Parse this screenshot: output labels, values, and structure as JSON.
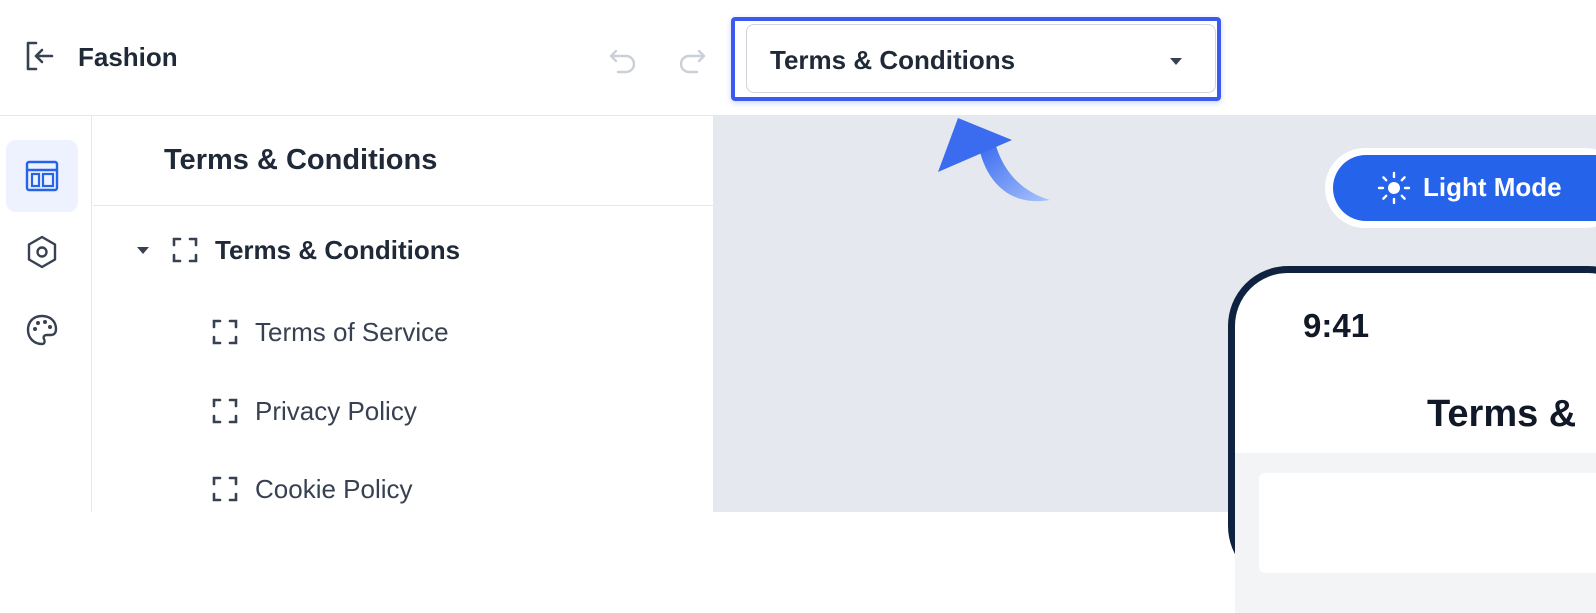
{
  "header": {
    "app_title": "Fashion",
    "icons": {
      "back": "exit-icon",
      "undo": "undo-icon",
      "redo": "redo-icon"
    },
    "page_select": {
      "value": "Terms & Conditions",
      "caret": "caret-down-icon"
    }
  },
  "rail": {
    "items": [
      {
        "icon": "layout-icon",
        "active": true
      },
      {
        "icon": "settings-icon",
        "active": false
      },
      {
        "icon": "palette-icon",
        "active": false
      }
    ]
  },
  "panel": {
    "title": "Terms & Conditions",
    "tree": [
      {
        "label": "Terms & Conditions",
        "expanded": true,
        "level": 0
      },
      {
        "label": "Terms of Service",
        "level": 1
      },
      {
        "label": "Privacy Policy",
        "level": 1
      },
      {
        "label": "Cookie Policy",
        "level": 1
      }
    ]
  },
  "canvas": {
    "mode_toggle": {
      "label": "Light Mode",
      "icon": "sun-icon"
    },
    "phone": {
      "time": "9:41",
      "title": "Terms &"
    }
  },
  "colors": {
    "accent": "#2563eb",
    "highlight": "#3b5bf0",
    "phone_frame": "#0f2340",
    "canvas_bg": "#e5e8ee"
  }
}
